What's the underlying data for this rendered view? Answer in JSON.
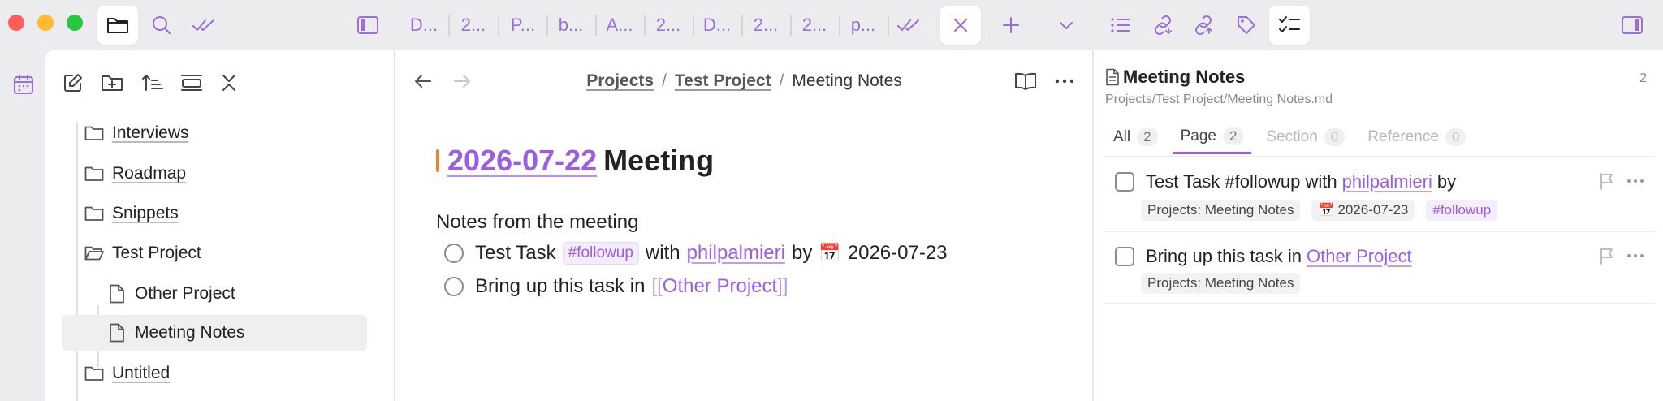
{
  "tabs": [
    "D...",
    "2...",
    "P...",
    "b...",
    "A...",
    "2...",
    "D...",
    "2...",
    "2...",
    "p..."
  ],
  "breadcrumb": {
    "part1": "Projects",
    "part2": "Test Project",
    "current": "Meeting Notes",
    "sep": "/"
  },
  "tree": {
    "items": [
      {
        "label": "Interviews"
      },
      {
        "label": "Roadmap"
      },
      {
        "label": "Snippets"
      },
      {
        "label": "Test Project"
      },
      {
        "label": "Other Project"
      },
      {
        "label": "Meeting Notes"
      },
      {
        "label": "Untitled"
      }
    ]
  },
  "editor": {
    "heading_date": "2026-07-22",
    "heading_rest": "Meeting",
    "para": "Notes from the meeting",
    "task1": {
      "pre": "Test Task",
      "tag": "#followup",
      "with": "with",
      "user": "philpalmieri",
      "by": "by",
      "emoji": "📅",
      "date": "2026-07-23"
    },
    "task2": {
      "pre": "Bring up this task in",
      "open": "[[",
      "link": "Other Project",
      "close": "]]"
    }
  },
  "right": {
    "title": "Meeting Notes",
    "path": "Projects/Test Project/Meeting Notes.md",
    "count": "2",
    "tabs": [
      {
        "label": "All",
        "count": "2"
      },
      {
        "label": "Page",
        "count": "2"
      },
      {
        "label": "Section",
        "count": "0"
      },
      {
        "label": "Reference",
        "count": "0"
      }
    ],
    "task1": {
      "text": "Test Task #followup with",
      "user": "philpalmieri",
      "by": "by",
      "chip_source": "Projects: Meeting Notes",
      "chip_emoji": "📅",
      "chip_date": "2026-07-23",
      "chip_tag": "#followup"
    },
    "task2": {
      "text": "Bring up this task in",
      "link": "Other Project",
      "chip_source": "Projects: Meeting Notes"
    }
  },
  "colors": {
    "accent": "#9b5de5",
    "heading_bar": "#e9852a",
    "red": "#ff5f57",
    "yellow": "#febc2e",
    "green": "#28c840"
  }
}
